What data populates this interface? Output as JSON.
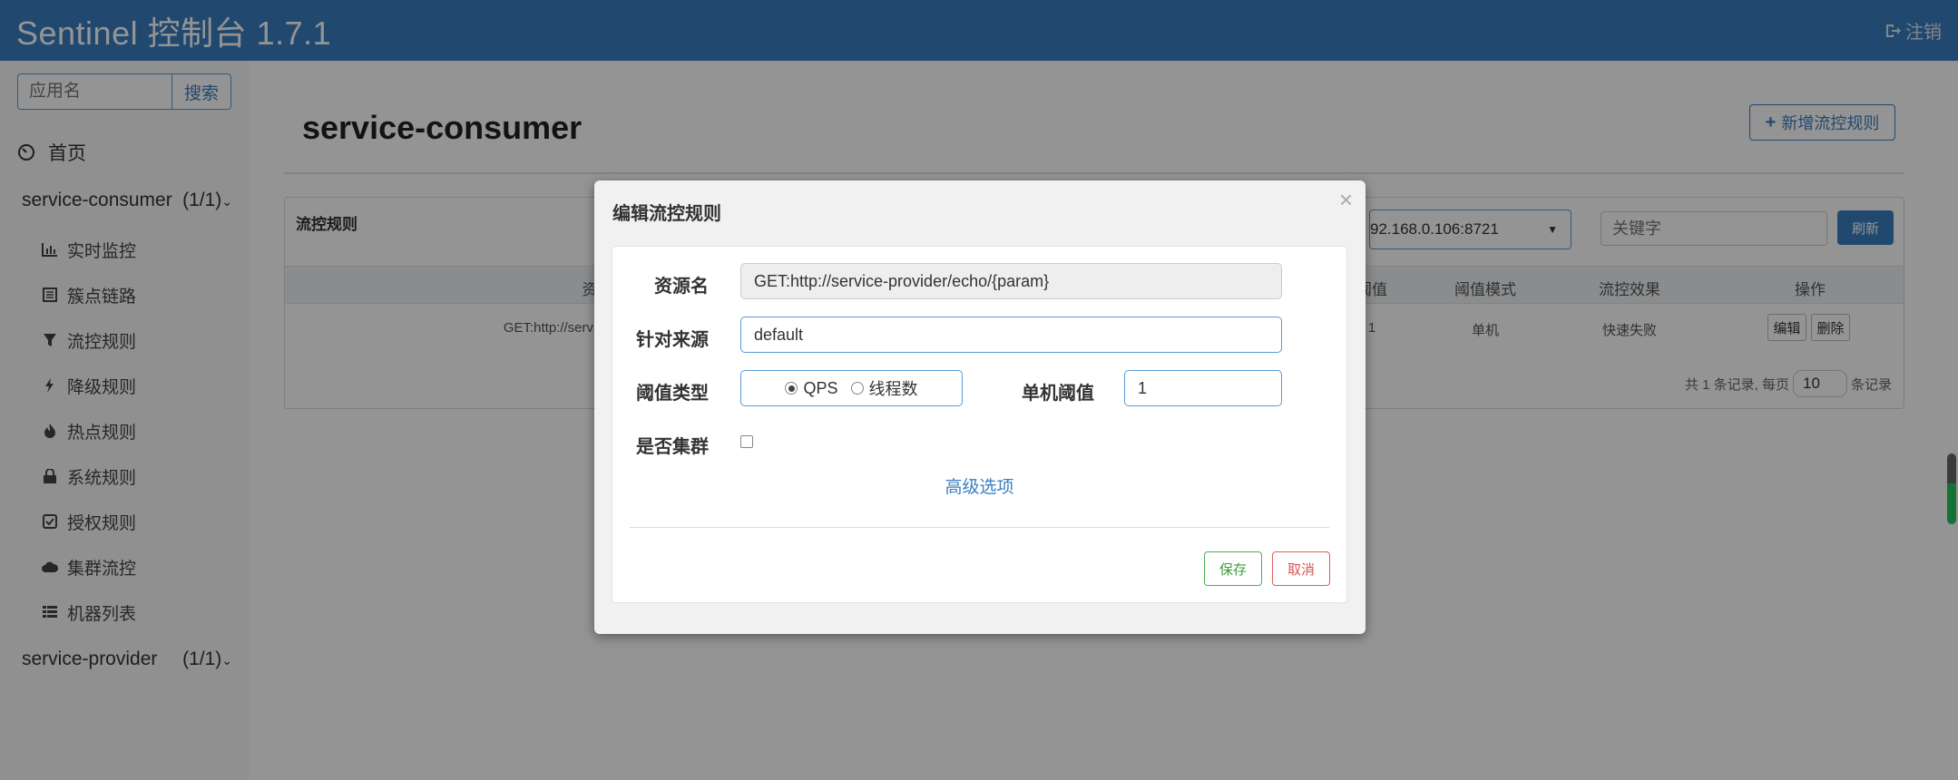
{
  "header": {
    "brand": "Sentinel 控制台 1.7.1",
    "logout_label": "注销"
  },
  "sidebar": {
    "search_placeholder": "应用名",
    "search_button": "搜索",
    "home_label": "首页",
    "apps": [
      {
        "name": "service-consumer",
        "count": "(1/1)"
      },
      {
        "name": "service-provider",
        "count": "(1/1)"
      }
    ],
    "sub_items": [
      {
        "label": "实时监控",
        "icon": "bar-chart-icon"
      },
      {
        "label": "簇点链路",
        "icon": "list-icon"
      },
      {
        "label": "流控规则",
        "icon": "filter-icon"
      },
      {
        "label": "降级规则",
        "icon": "flash-icon"
      },
      {
        "label": "热点规则",
        "icon": "fire-icon"
      },
      {
        "label": "系统规则",
        "icon": "lock-icon"
      },
      {
        "label": "授权规则",
        "icon": "check-square-icon"
      },
      {
        "label": "集群流控",
        "icon": "cloud-icon"
      },
      {
        "label": "机器列表",
        "icon": "table-list-icon"
      }
    ]
  },
  "main": {
    "page_title": "service-consumer",
    "new_rule_button": "新增流控规则",
    "panel_title": "流控规则",
    "machine_select": "92.168.0.106:8721",
    "keyword_placeholder": "关键字",
    "refresh_button": "刷新",
    "table_headers": {
      "resource": "资",
      "threshold": "阈值",
      "mode": "阈值模式",
      "effect": "流控效果",
      "ops": "操作"
    },
    "row": {
      "resource": "GET:http://service",
      "threshold": "1",
      "mode": "单机",
      "effect": "快速失败",
      "edit": "编辑",
      "delete": "删除"
    },
    "pager": {
      "prefix": "共 1 条记录, 每页",
      "page_size": "10",
      "suffix": "条记录"
    }
  },
  "modal": {
    "title": "编辑流控规则",
    "close": "×",
    "resource_label": "资源名",
    "resource_value": "GET:http://service-provider/echo/{param}",
    "origin_label": "针对来源",
    "origin_value": "default",
    "grade_label": "阈值类型",
    "grade_options": [
      "QPS",
      "线程数"
    ],
    "grade_selected": "QPS",
    "count_label": "单机阈值",
    "count_value": "1",
    "cluster_label": "是否集群",
    "cluster_checked": false,
    "advanced_link": "高级选项",
    "save_button": "保存",
    "cancel_button": "取消"
  }
}
